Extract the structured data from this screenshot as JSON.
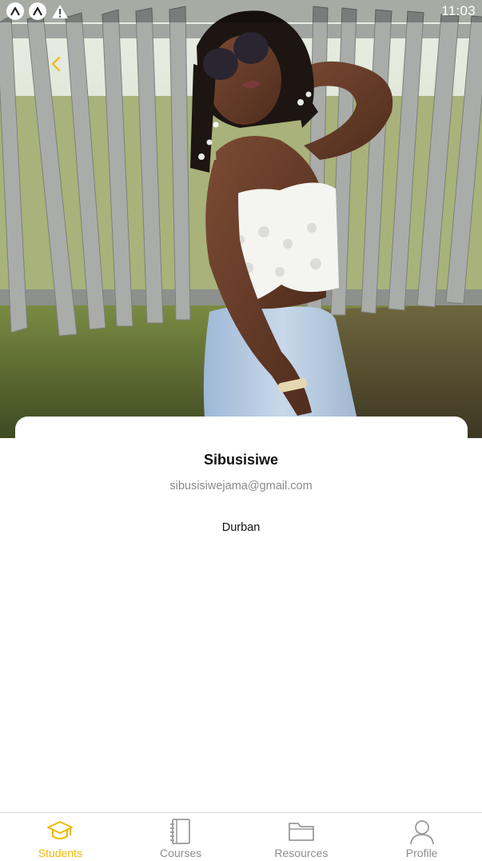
{
  "status_bar": {
    "time": "11:03",
    "icons": [
      "app-notification-icon",
      "app-notification-icon",
      "warning-icon"
    ]
  },
  "header": {
    "back_icon": "chevron-left-icon",
    "photo": "profile-photo"
  },
  "profile": {
    "name": "Sibusisiwe",
    "email": "sibusisiwejama@gmail.com",
    "city": "Durban"
  },
  "bottom_nav": {
    "items": [
      {
        "label": "Students",
        "icon": "graduation-cap-icon",
        "active": true
      },
      {
        "label": "Courses",
        "icon": "notebook-icon",
        "active": false
      },
      {
        "label": "Resources",
        "icon": "folder-icon",
        "active": false
      },
      {
        "label": "Profile",
        "icon": "user-icon",
        "active": false
      }
    ]
  },
  "colors": {
    "accent": "#f0b800",
    "inactive": "#8e8e8e",
    "text": "#111111",
    "muted": "#8a8a8a"
  }
}
